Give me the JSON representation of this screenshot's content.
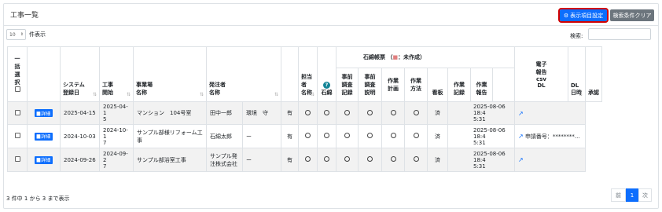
{
  "header": {
    "title": "工事一覧",
    "display_items_label": "表示項目設定",
    "clear_search_label": "検索条件クリア"
  },
  "controls": {
    "page_length_value": "10",
    "page_length_label": "件表示",
    "search_label": "検索:",
    "search_value": ""
  },
  "table": {
    "columns": {
      "bulk_select": [
        "一",
        "括",
        "選",
        "択"
      ],
      "system_date": [
        "システム",
        "登録日"
      ],
      "start": [
        "工事",
        "開始"
      ],
      "site": [
        "事業場",
        "名称"
      ],
      "orderer": [
        "発注者",
        "名称"
      ],
      "staff": [
        "担当者",
        "名称"
      ],
      "asbestos": "石綿",
      "report_group": "石綿帳票",
      "report_note": "（",
      "report_note_mark": "■",
      "report_note_rest": "：未作成）",
      "pre_survey_record": [
        "事前",
        "調査",
        "記録"
      ],
      "pre_survey_explain": [
        "事前",
        "調査",
        "説明"
      ],
      "work_plan": [
        "作業",
        "計画"
      ],
      "work_method": [
        "作業",
        "方法"
      ],
      "signboard": "看板",
      "work_record": [
        "作業",
        "記録"
      ],
      "work_report": [
        "作業",
        "報告"
      ],
      "e_report": [
        "電子",
        "報告",
        "csv",
        "DL"
      ],
      "dl_datetime": "DL日時",
      "approval": "承認"
    },
    "detail_label": "詳細",
    "rows": [
      {
        "system_date": "2025-04-15",
        "start": [
          "2025-04-1",
          "5"
        ],
        "site": "マンション　104号室",
        "orderer": "田中一郎",
        "extra": "環境　守",
        "flag": "有",
        "signboard": "済",
        "dl_datetime": [
          "2025-08-06 18:4",
          "5:31"
        ],
        "application": ""
      },
      {
        "system_date": "2024-10-03",
        "start": [
          "2024-10-1",
          "7"
        ],
        "site": "サンプル部様リフォーム工事",
        "orderer": "石綿太郎",
        "extra": "ー",
        "flag": "有",
        "signboard": "済",
        "dl_datetime": [
          "2025-08-06 18:4",
          "5:31"
        ],
        "application": "申請番号：********..."
      },
      {
        "system_date": "2024-09-26",
        "start": [
          "2024-09-2",
          "7"
        ],
        "site": "サンプル部浴室工事",
        "orderer": "サンプル発注株式会社",
        "extra": "ー",
        "flag": "有",
        "signboard": "済",
        "dl_datetime": [
          "2025-08-06 18:4",
          "5:31"
        ],
        "application": ""
      }
    ]
  },
  "footer": {
    "info": "3 件中 1 から 3 まで表示",
    "prev": "前",
    "page": "1",
    "next": "次"
  },
  "colors": {
    "primary": "#0d6efd",
    "highlight": "#d10000",
    "secondary": "#6c757d"
  }
}
